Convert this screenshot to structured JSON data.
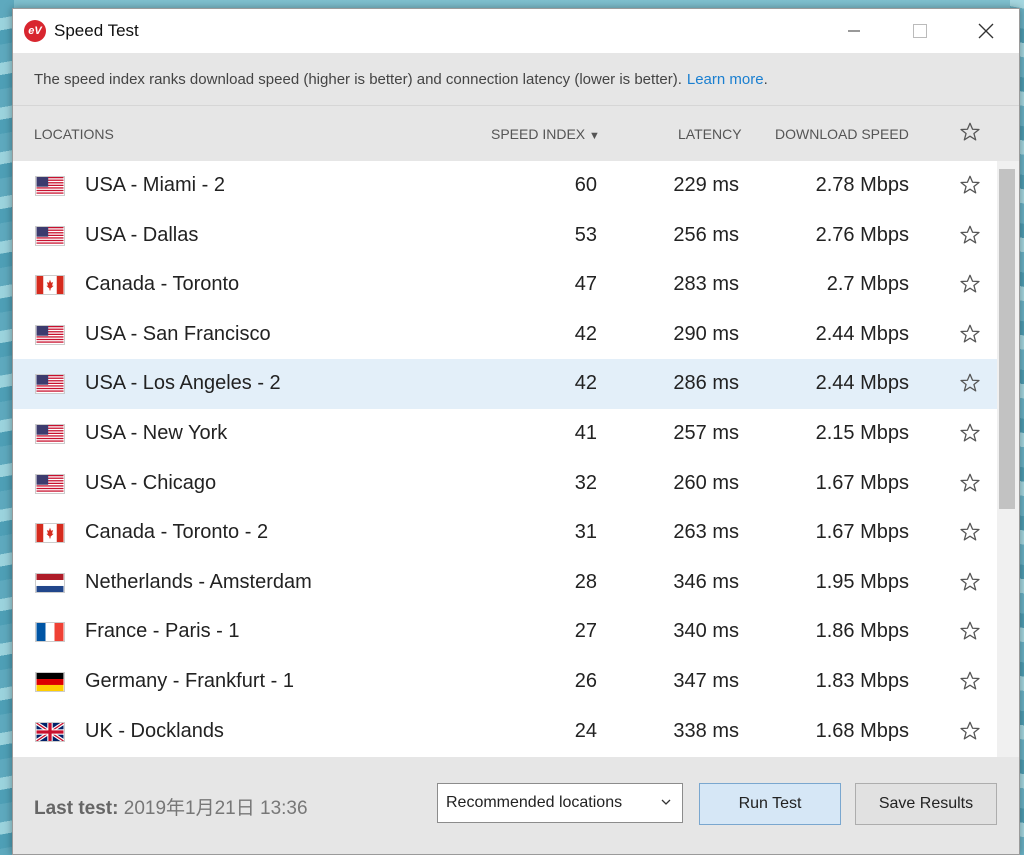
{
  "window": {
    "title": "Speed Test",
    "app_icon": "expressvpn-icon"
  },
  "info": {
    "text": "The speed index ranks download speed (higher is better) and connection latency (lower is better).",
    "link": "Learn more",
    "suffix": "."
  },
  "columns": {
    "locations": "LOCATIONS",
    "speed_index": "SPEED INDEX",
    "sort_indicator": "▼",
    "latency": "LATENCY",
    "download": "DOWNLOAD SPEED"
  },
  "rows": [
    {
      "flag": "us",
      "location": "USA - Miami - 2",
      "speed": "60",
      "latency": "229 ms",
      "download": "2.78 Mbps"
    },
    {
      "flag": "us",
      "location": "USA - Dallas",
      "speed": "53",
      "latency": "256 ms",
      "download": "2.76 Mbps"
    },
    {
      "flag": "ca",
      "location": "Canada - Toronto",
      "speed": "47",
      "latency": "283 ms",
      "download": "2.7 Mbps"
    },
    {
      "flag": "us",
      "location": "USA - San Francisco",
      "speed": "42",
      "latency": "290 ms",
      "download": "2.44 Mbps"
    },
    {
      "flag": "us",
      "location": "USA - Los Angeles - 2",
      "speed": "42",
      "latency": "286 ms",
      "download": "2.44 Mbps",
      "selected": true
    },
    {
      "flag": "us",
      "location": "USA - New York",
      "speed": "41",
      "latency": "257 ms",
      "download": "2.15 Mbps"
    },
    {
      "flag": "us",
      "location": "USA - Chicago",
      "speed": "32",
      "latency": "260 ms",
      "download": "1.67 Mbps"
    },
    {
      "flag": "ca",
      "location": "Canada - Toronto - 2",
      "speed": "31",
      "latency": "263 ms",
      "download": "1.67 Mbps"
    },
    {
      "flag": "nl",
      "location": "Netherlands - Amsterdam",
      "speed": "28",
      "latency": "346 ms",
      "download": "1.95 Mbps"
    },
    {
      "flag": "fr",
      "location": "France - Paris - 1",
      "speed": "27",
      "latency": "340 ms",
      "download": "1.86 Mbps"
    },
    {
      "flag": "de",
      "location": "Germany - Frankfurt - 1",
      "speed": "26",
      "latency": "347 ms",
      "download": "1.83 Mbps"
    },
    {
      "flag": "gb",
      "location": "UK - Docklands",
      "speed": "24",
      "latency": "338 ms",
      "download": "1.68 Mbps"
    }
  ],
  "footer": {
    "last_test_label": "Last test:",
    "last_test_value": "2019年1月21日 13:36",
    "select_value": "Recommended locations",
    "run_label": "Run Test",
    "save_label": "Save Results"
  },
  "colors": {
    "link": "#1a7fd0",
    "selected_row": "#e3eff9",
    "run_button": "#d6e7f6",
    "brand": "#d8262f"
  }
}
